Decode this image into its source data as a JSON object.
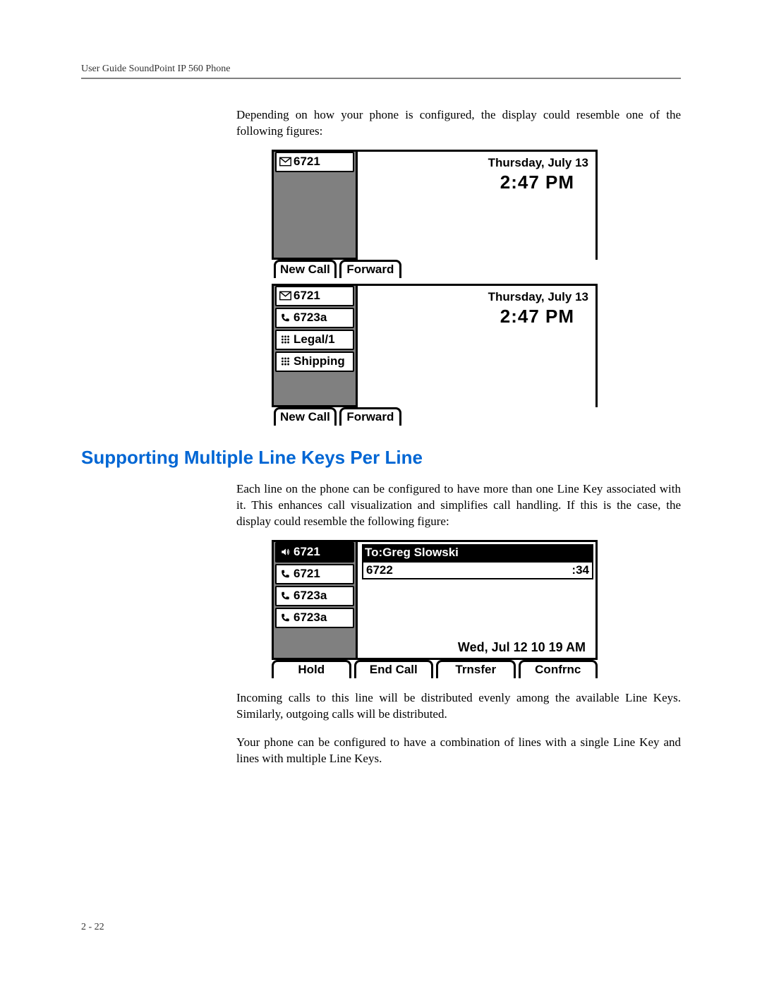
{
  "header": {
    "running_head": "User Guide SoundPoint IP 560 Phone"
  },
  "page_number": "2 - 22",
  "para_intro": "Depending on how your phone is configured, the display could resemble one of the following figures:",
  "section_heading": "Supporting Multiple Line Keys Per Line",
  "para_section_1": "Each line on the phone can be configured to have more than one Line Key associated with it. This enhances call visualization and simplifies call handling. If this is the case, the display could resemble the following figure:",
  "para_after_1": "Incoming calls to this line will be distributed evenly among the available Line Keys. Similarly, outgoing calls will be distributed.",
  "para_after_2": "Your phone can be configured to have a combination of lines with a single Line Key and lines with multiple Line Keys.",
  "lcd1": {
    "lines": [
      {
        "label": "6721",
        "icon": "envelope"
      }
    ],
    "date": "Thursday, July 13",
    "time": "2:47 PM",
    "softkeys": [
      "New Call",
      "Forward"
    ]
  },
  "lcd2": {
    "lines": [
      {
        "label": "6721",
        "icon": "envelope"
      },
      {
        "label": "6723a",
        "icon": "phone"
      },
      {
        "label": "Legal/1",
        "icon": "dialpad"
      },
      {
        "label": "Shipping",
        "icon": "dialpad"
      }
    ],
    "date": "Thursday, July 13",
    "time": "2:47 PM",
    "softkeys": [
      "New Call",
      "Forward"
    ]
  },
  "lcd3": {
    "lines": [
      {
        "label": "6721",
        "icon": "speaker",
        "active": true
      },
      {
        "label": "6721",
        "icon": "phone"
      },
      {
        "label": "6723a",
        "icon": "phone"
      },
      {
        "label": "6723a",
        "icon": "phone"
      }
    ],
    "call_header": "To:Greg Slowski",
    "call_number": "6722",
    "call_timer": ":34",
    "datetime": "Wed, Jul 12  10 19 AM",
    "softkeys": [
      "Hold",
      "End Call",
      "Trnsfer",
      "Confrnc"
    ]
  }
}
